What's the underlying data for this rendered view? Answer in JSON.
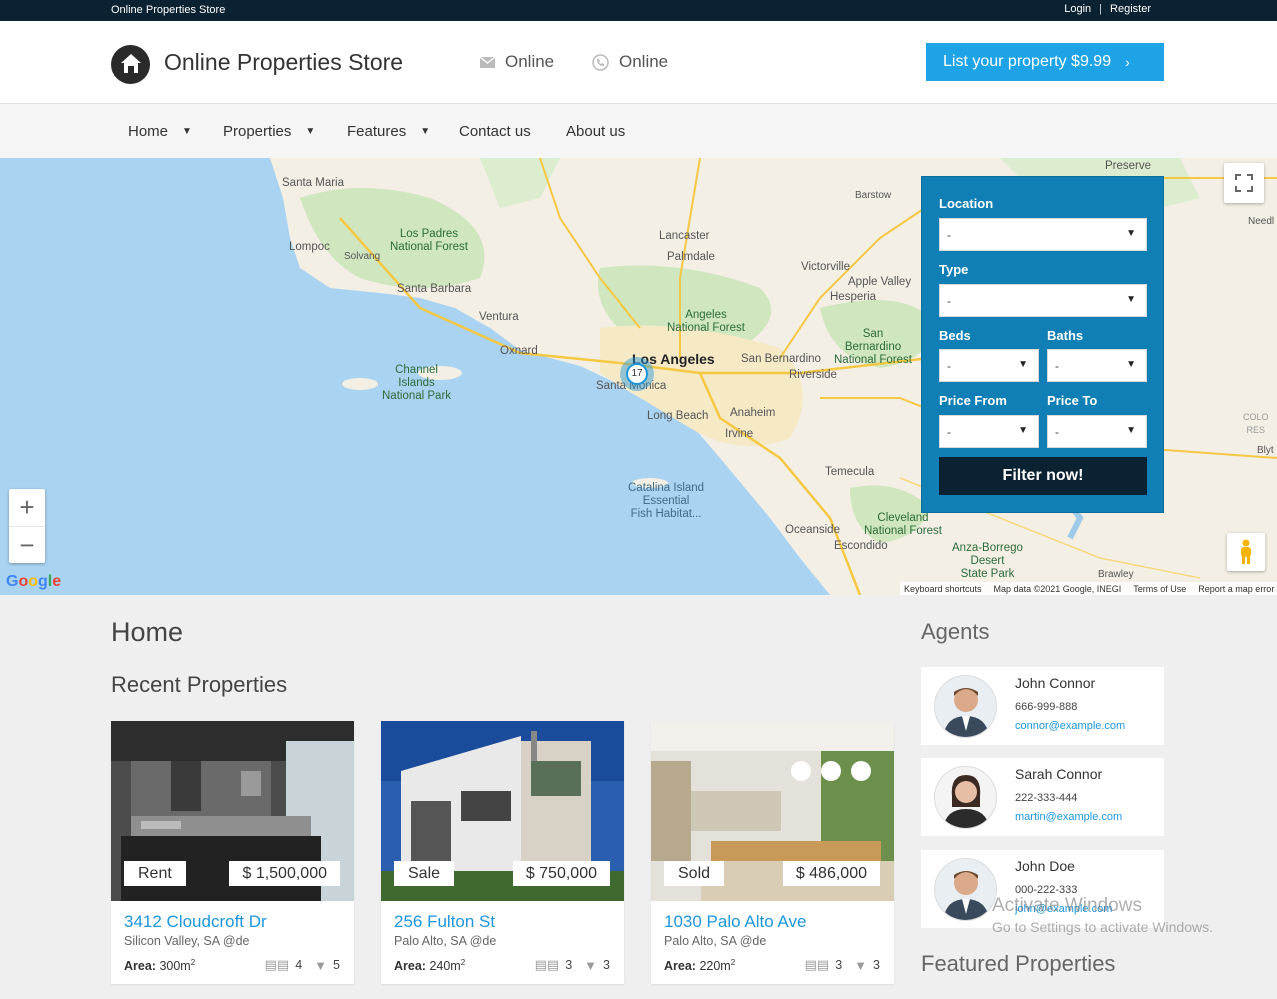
{
  "topbar": {
    "brand": "Online Properties Store",
    "login": "Login",
    "separator": "|",
    "register": "Register"
  },
  "header": {
    "title": "Online Properties Store",
    "contact_email": "Online",
    "contact_phone": "Online",
    "list_button": "List your property $9.99"
  },
  "nav": [
    {
      "label": "Home",
      "has_dropdown": true
    },
    {
      "label": "Properties",
      "has_dropdown": true
    },
    {
      "label": "Features",
      "has_dropdown": true
    },
    {
      "label": "Contact us",
      "has_dropdown": false
    },
    {
      "label": "About us",
      "has_dropdown": false
    }
  ],
  "map": {
    "cluster_count": "17",
    "labels": {
      "santa_maria": "Santa Maria",
      "lompoc": "Lompoc",
      "solvang": "Solvang",
      "los_padres": "Los Padres\nNational Forest",
      "santa_barbara": "Santa Barbara",
      "ventura": "Ventura",
      "oxnard": "Oxnard",
      "channel_islands": "Channel\nIslands\nNational Park",
      "lancaster": "Lancaster",
      "palmdale": "Palmdale",
      "victorville": "Victorville",
      "apple_valley": "Apple Valley",
      "hesperia": "Hesperia",
      "barstow": "Barstow",
      "preserve": "Preserve",
      "needles": "Needl",
      "angeles": "Angeles\nNational Forest",
      "los_angeles": "Los Angeles",
      "santa_monica": "Santa Monica",
      "long_beach": "Long Beach",
      "anaheim": "Anaheim",
      "irvine": "Irvine",
      "san_bernardino": "San Bernardino",
      "sb_forest": "San\nBernardino\nNational Forest",
      "riverside": "Riverside",
      "temecula": "Temecula",
      "catalina": "Catalina Island\nEssential\nFish Habitat...",
      "oceanside": "Oceanside",
      "escondido": "Escondido",
      "cleveland": "Cleveland\nNational Forest",
      "anza": "Anza-Borrego\nDesert\nState Park",
      "brawley": "Brawley",
      "colo": "COLO\nRES",
      "blyt": "Blyt"
    },
    "google": "Google",
    "footer": [
      "Keyboard shortcuts",
      "Map data ©2021 Google, INEGI",
      "Terms of Use",
      "Report a map error"
    ],
    "zoom_in": "+",
    "zoom_out": "−"
  },
  "filter": {
    "location_label": "Location",
    "location_value": "-",
    "type_label": "Type",
    "type_value": "-",
    "beds_label": "Beds",
    "beds_value": "-",
    "baths_label": "Baths",
    "baths_value": "-",
    "price_from_label": "Price From",
    "price_from_value": "-",
    "price_to_label": "Price To",
    "price_to_value": "-",
    "button": "Filter now!"
  },
  "main": {
    "page_title": "Home",
    "recent_title": "Recent Properties",
    "agents_title": "Agents",
    "featured_title": "Featured Properties"
  },
  "properties": [
    {
      "status": "Rent",
      "price": "$ 1,500,000",
      "address": "3412 Cloudcroft Dr",
      "city": "Silicon Valley, SA @de",
      "area_label": "Area:",
      "area": "300m",
      "beds": "4",
      "baths": "5"
    },
    {
      "status": "Sale",
      "price": "$ 750,000",
      "address": "256 Fulton St",
      "city": "Palo Alto, SA @de",
      "area_label": "Area:",
      "area": "240m",
      "beds": "3",
      "baths": "3"
    },
    {
      "status": "Sold",
      "price": "$ 486,000",
      "address": "1030 Palo Alto Ave",
      "city": "Palo Alto, SA @de",
      "area_label": "Area:",
      "area": "220m",
      "beds": "3",
      "baths": "3"
    }
  ],
  "agents": [
    {
      "name": "John Connor",
      "phone": "666-999-888",
      "email": "connor@example.com"
    },
    {
      "name": "Sarah Connor",
      "phone": "222-333-444",
      "email": "martin@example.com"
    },
    {
      "name": "John Doe",
      "phone": "000-222-333",
      "email": "john@example.com"
    }
  ],
  "watermark": {
    "line1": "Activate Windows",
    "line2": "Go to Settings to activate Windows."
  },
  "colors": {
    "accent": "#1ea3e6",
    "dark": "#0b2233",
    "filter_bg": "#0f7fb5",
    "link": "#1e96dc"
  }
}
